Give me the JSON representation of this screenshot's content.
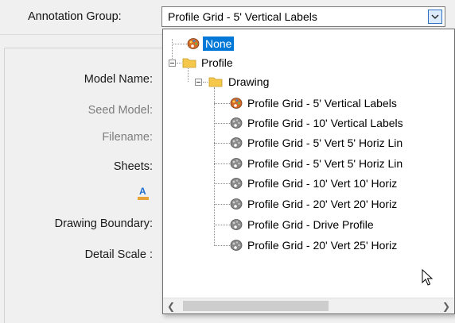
{
  "annotation_group": {
    "label": "Annotation Group:",
    "value": "Profile Grid - 5' Vertical Labels"
  },
  "form": {
    "model_name": "Model Name:",
    "seed_model": "Seed Model:",
    "filename": "Filename:",
    "sheets": "Sheets:",
    "drawing_boundary": "Drawing Boundary:",
    "detail_scale": "Detail Scale :"
  },
  "tree": {
    "none": "None",
    "profile": "Profile",
    "drawing": "Drawing",
    "items": [
      "Profile Grid - 5' Vertical Labels",
      "Profile Grid - 10' Vertical Labels",
      "Profile Grid - 5' Vert 5' Horiz Lin",
      "Profile Grid - 5' Vert 5' Horiz Lin",
      "Profile Grid - 10' Vert 10' Horiz",
      "Profile Grid - 20' Vert 20' Horiz",
      "Profile Grid - Drive Profile",
      "Profile Grid - 20' Vert 25' Horiz"
    ]
  },
  "colors": {
    "selection": "#0078d7",
    "folder": "#f5c84b"
  }
}
